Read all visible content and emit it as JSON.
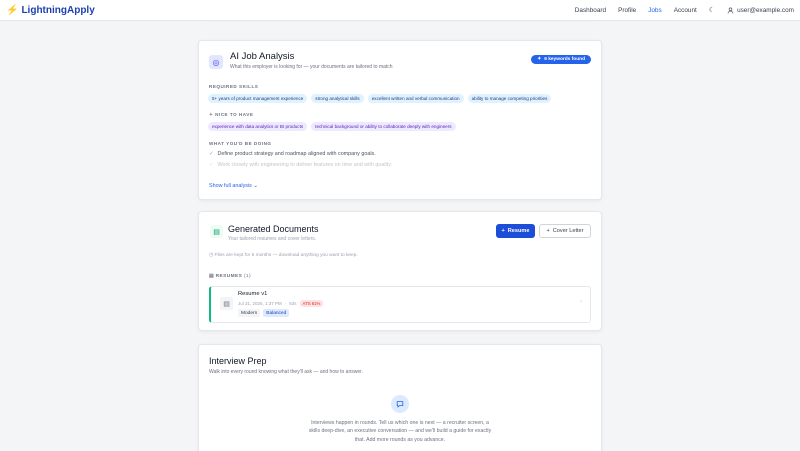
{
  "nav": {
    "brand": "LightningApply",
    "links": [
      "Dashboard",
      "Profile",
      "Jobs",
      "Account"
    ],
    "active": "Jobs",
    "user_email": "user@example.com"
  },
  "icons": {
    "brand": "lightning-bolt-icon",
    "theme": "moon-icon",
    "user": "user-icon",
    "ai": "target-icon",
    "keywords": "sparkle-icon",
    "docs": "document-icon",
    "file": "file-icon",
    "clock": "clock-icon",
    "interview": "chat-bubble-icon"
  },
  "colors": {
    "accent": "#2563eb",
    "brand": "#1e40af",
    "bolt": "#f59e0b",
    "success": "#10b981",
    "ats_warning": "#dc2626"
  },
  "ai_analysis": {
    "title": "AI Job Analysis",
    "subtitle": "What this employer is looking for — your documents are tailored to match",
    "keywords_badge": "6 keywords found",
    "required_label": "REQUIRED SKILLS",
    "required_skills": [
      "5+ years of product management experience",
      "strong analytical skills",
      "excellent written and verbal communication",
      "ability to manage competing priorities"
    ],
    "nice_label": "NICE TO HAVE",
    "nice_to_have": [
      "experience with data analytics or BI products",
      "technical background or ability to collaborate deeply with engineers"
    ],
    "doing_label": "WHAT YOU'D BE DOING",
    "doing": [
      "Define product strategy and roadmap aligned with company goals.",
      "Work closely with engineering to deliver features on time and with quality."
    ],
    "show_full": "Show full analysis"
  },
  "documents": {
    "title": "Generated Documents",
    "subtitle": "Your tailored resumes and cover letters.",
    "resume_button": "Resume",
    "cover_button": "Cover Letter",
    "files_note": "Files are kept for 6 months — download anything you want to keep.",
    "resumes_label": "RESUMES",
    "resumes_count": "(1)",
    "resume": {
      "name": "Resume v1",
      "date": "Jul 31, 2026, 1:37 PM",
      "duration": "53s",
      "ats": "ATS 61%",
      "template": "Modern",
      "tone": "Balanced"
    }
  },
  "interview": {
    "title": "Interview Prep",
    "subtitle": "Walk into every round knowing what they'll ask — and how to answer.",
    "description": "Interviews happen in rounds. Tell us which one is next — a recruiter screen, a skills deep-dive, an executive conversation — and we'll build a guide for exactly that. Add more rounds as you advance."
  }
}
